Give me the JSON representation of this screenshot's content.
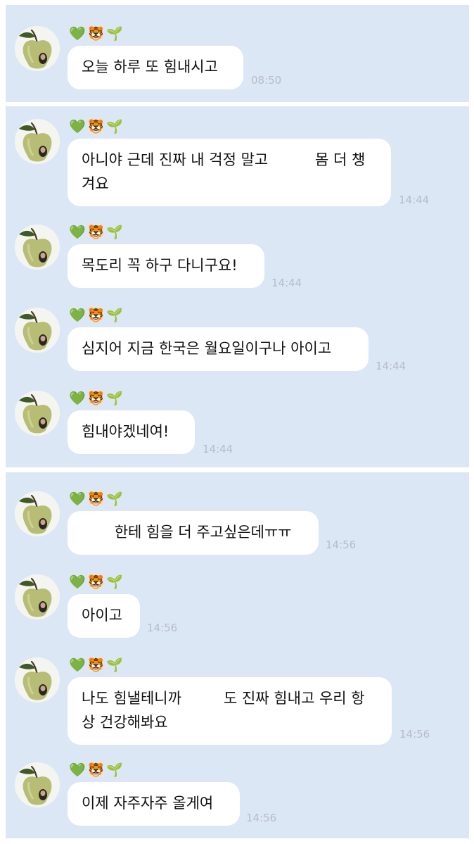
{
  "sender": {
    "name_emoji": [
      "💚",
      "🐯",
      "🌱"
    ]
  },
  "colors": {
    "panel_bg": "#dce7f6",
    "bubble_bg": "#ffffff",
    "time_text": "#b6bcc6"
  },
  "messages": [
    {
      "text": "오늘 하루 또 힘내시고",
      "time": "08:50"
    },
    {
      "text": "아니야 근데 진짜 내 걱정 말고          몸 더 챙\n겨요",
      "time": "14:44"
    },
    {
      "text": "목도리 꼭 하구 다니구요!",
      "time": "14:44"
    },
    {
      "text": "심지어 지금 한국은 월요일이구나 아이고",
      "time": "14:44"
    },
    {
      "text": "힘내야겠네여!",
      "time": "14:44"
    },
    {
      "text": "       한테 힘을 더 주고싶은데ㅠㅠ",
      "time": "14:56"
    },
    {
      "text": "아이고",
      "time": "14:56"
    },
    {
      "text": "나도 힘낼테니까         도 진짜 힘내고 우리 항\n상 건강해봐요",
      "time": "14:56"
    },
    {
      "text": "이제 자주자주 올게여",
      "time": "14:56"
    }
  ]
}
